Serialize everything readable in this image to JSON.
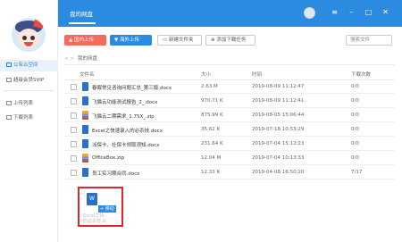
{
  "sidebar": {
    "items": [
      {
        "label": "公有云空间",
        "active": true
      },
      {
        "label": "超级会员SVIP",
        "active": false
      },
      {
        "label": "上传列表",
        "active": false
      },
      {
        "label": "下载列表",
        "active": false
      }
    ]
  },
  "header": {
    "title": "我的网盘",
    "window_buttons": {
      "menu": "≡",
      "minimize": "–",
      "maximize": "□",
      "close": "✕"
    }
  },
  "toolbar": {
    "upload_label": "▲ 国内上传",
    "download_label": "▼ 海外上传",
    "new_folder_label": "新建文件夹",
    "add_download_label": "添加下载任务",
    "search_placeholder": "搜索文件"
  },
  "breadcrumb": {
    "arrows": "< >",
    "path": "我的网盘"
  },
  "table": {
    "columns": [
      "文件名",
      "大小",
      "时间",
      "下载次数"
    ],
    "rows": [
      {
        "name": "春眠常见咨询问题汇总_第三版.docx",
        "size": "2.63 M",
        "time": "2019-08-09 11:12:47",
        "count": "0/0",
        "icon": "word-icon"
      },
      {
        "name": "飞猫云功能测试报告_2_.docx",
        "size": "970.71 K",
        "time": "2019-08-09 11:12:41",
        "count": "0/0",
        "icon": "word-icon"
      },
      {
        "name": "飞猫云二期需求_1.75X_.zip",
        "size": "875.99 K",
        "time": "2019-08-05 15:06:44",
        "count": "0/0",
        "icon": "zip-icon"
      },
      {
        "name": "Excel之快速录入的必杀技.docx",
        "size": "35.62 K",
        "time": "2019-07-18 10:53:29",
        "count": "0/0",
        "icon": "word-icon"
      },
      {
        "name": "派保卡、社保卡领取须知.docx",
        "size": "231.64 K",
        "time": "2019-07-04 15:12:23",
        "count": "0/0",
        "icon": "word-icon"
      },
      {
        "name": "OfficeBox.zip",
        "size": "12.04 M",
        "time": "2019-07-04 10:13:33",
        "count": "0/0",
        "icon": "zip-icon"
      },
      {
        "name": "员工实习期合同.docx",
        "size": "12.33 K",
        "time": "2019-04-08 16:50:20",
        "count": "7/17",
        "icon": "word-icon"
      }
    ]
  },
  "drag_preview": {
    "label": "+ 移动",
    "line1": "Excel之快...",
    "line2": "的必杀技.d..."
  },
  "colors": {
    "accent": "#2b8be0",
    "upload": "#f46b5c",
    "highlight": "#e0272b"
  }
}
